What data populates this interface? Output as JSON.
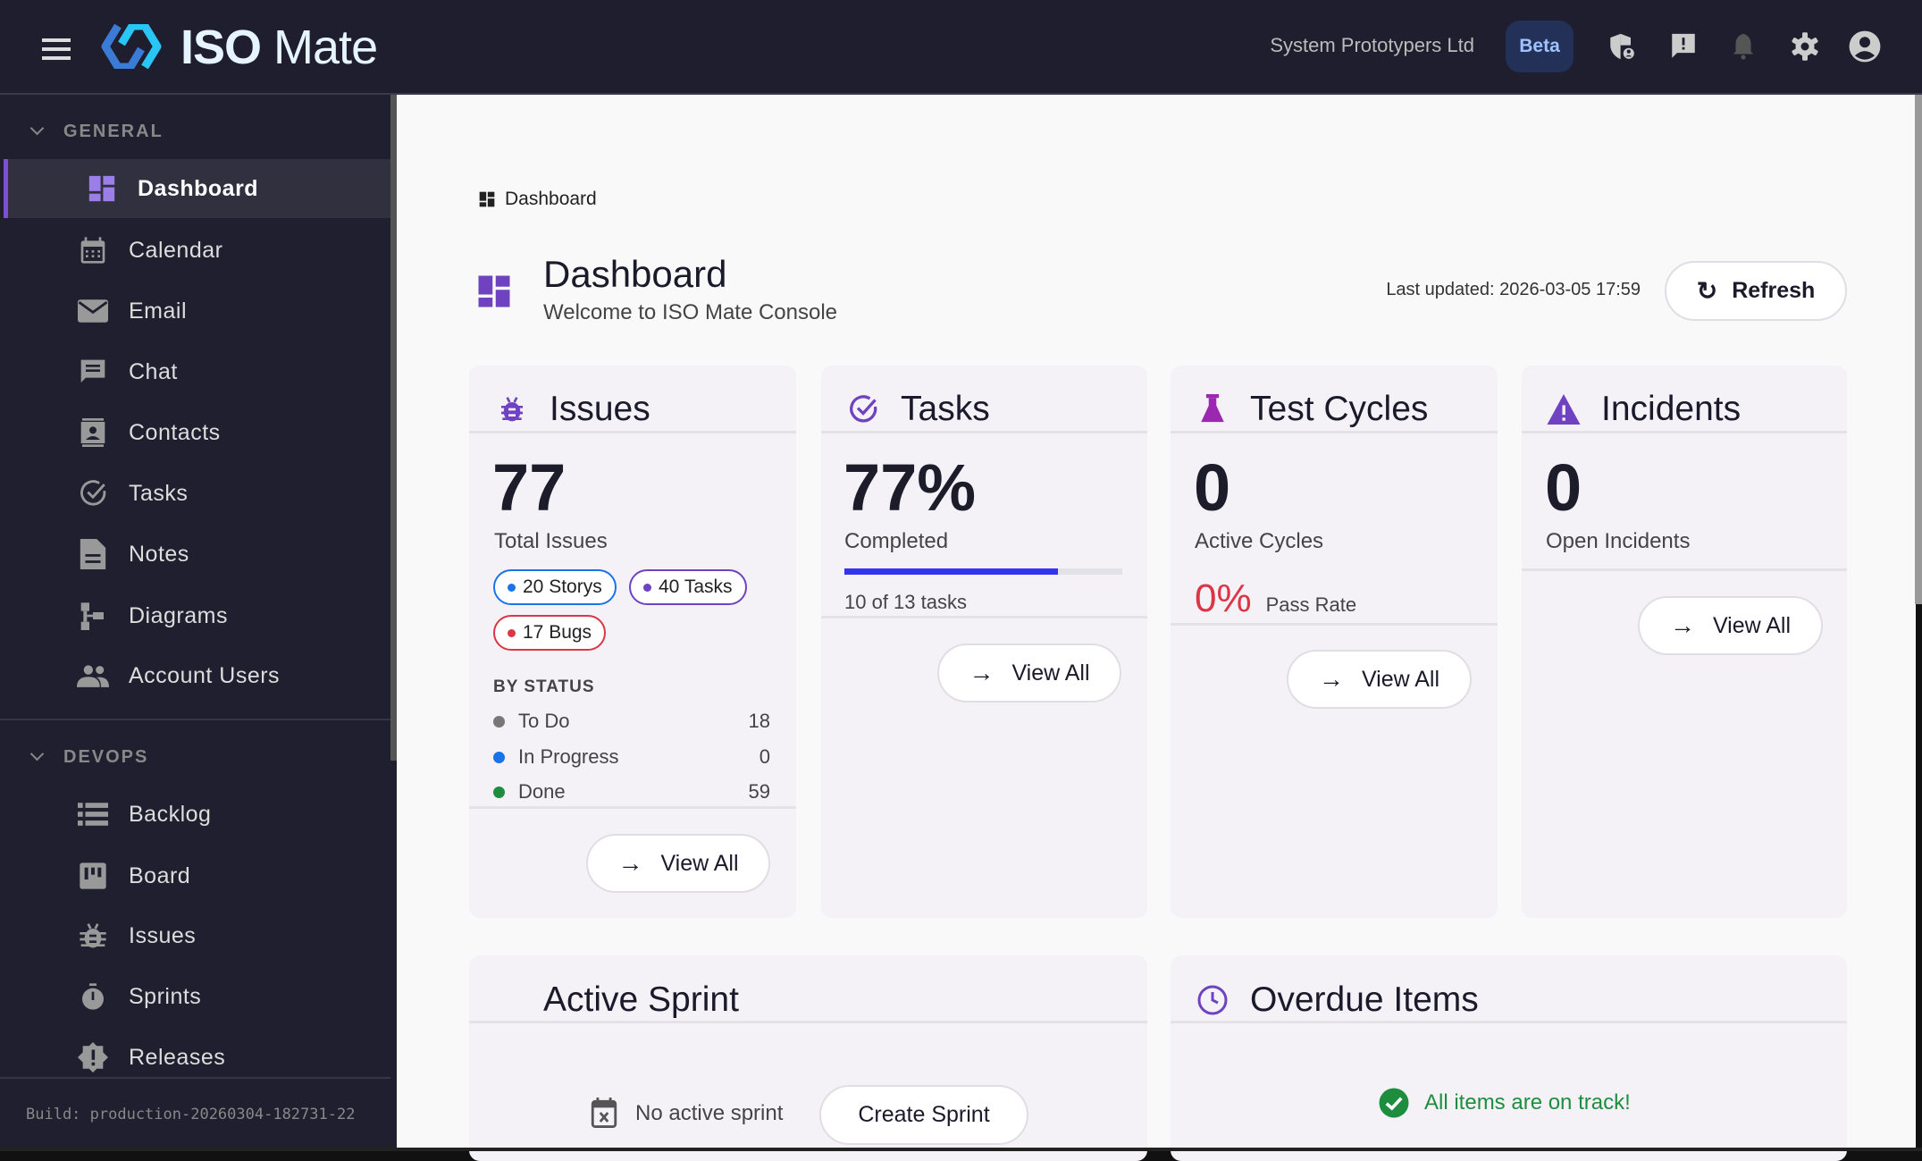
{
  "header": {
    "brand_bold": "ISO",
    "brand_light": "Mate",
    "organization": "System Prototypers Ltd",
    "badge": "Beta",
    "icons": [
      "menu-icon",
      "shield-user-icon",
      "feedback-icon",
      "bell-icon",
      "gear-icon",
      "account-icon"
    ]
  },
  "sidebar": {
    "sections": [
      {
        "title": "GENERAL",
        "items": [
          {
            "label": "Dashboard",
            "icon": "dashboard-icon",
            "active": true
          },
          {
            "label": "Calendar",
            "icon": "calendar-icon"
          },
          {
            "label": "Email",
            "icon": "email-icon"
          },
          {
            "label": "Chat",
            "icon": "chat-icon"
          },
          {
            "label": "Contacts",
            "icon": "contacts-icon"
          },
          {
            "label": "Tasks",
            "icon": "task-check-icon"
          },
          {
            "label": "Notes",
            "icon": "notes-icon"
          },
          {
            "label": "Diagrams",
            "icon": "diagram-icon"
          },
          {
            "label": "Account Users",
            "icon": "users-icon"
          }
        ]
      },
      {
        "title": "DEVOPS",
        "items": [
          {
            "label": "Backlog",
            "icon": "backlog-icon"
          },
          {
            "label": "Board",
            "icon": "board-icon"
          },
          {
            "label": "Issues",
            "icon": "bug-icon"
          },
          {
            "label": "Sprints",
            "icon": "timer-icon"
          },
          {
            "label": "Releases",
            "icon": "release-icon"
          }
        ]
      }
    ],
    "build": "Build: production-20260304-182731-22"
  },
  "main": {
    "breadcrumb": "Dashboard",
    "title": "Dashboard",
    "subtitle": "Welcome to ISO Mate Console",
    "last_updated": "Last updated: 2026-03-05 17:59",
    "refresh": "Refresh",
    "issues": {
      "title": "Issues",
      "total": "77",
      "total_label": "Total Issues",
      "chips": [
        {
          "label": "20 Storys",
          "color": "#1a73e8"
        },
        {
          "label": "40 Tasks",
          "color": "#6f42c1"
        },
        {
          "label": "17 Bugs",
          "color": "#dc3545"
        }
      ],
      "by_status": "BY STATUS",
      "status": [
        {
          "label": "To Do",
          "count": "18",
          "color": "#777"
        },
        {
          "label": "In Progress",
          "count": "0",
          "color": "#1a73e8"
        },
        {
          "label": "Done",
          "count": "59",
          "color": "#1e8e3e"
        }
      ],
      "view_all": "View All"
    },
    "tasks": {
      "title": "Tasks",
      "percent": "77%",
      "percent_label": "Completed",
      "progress": 77,
      "detail": "10 of 13 tasks",
      "view_all": "View All"
    },
    "test_cycles": {
      "title": "Test Cycles",
      "count": "0",
      "count_label": "Active Cycles",
      "pass_rate": "0%",
      "pass_label": "Pass Rate",
      "view_all": "View All"
    },
    "incidents": {
      "title": "Incidents",
      "count": "0",
      "count_label": "Open Incidents",
      "view_all": "View All"
    },
    "active_sprint": {
      "title": "Active Sprint",
      "empty": "No active sprint",
      "create": "Create Sprint"
    },
    "overdue": {
      "title": "Overdue Items",
      "message": "All items are on track!"
    }
  },
  "colors": {
    "accent": "#6f42c1",
    "progress": "#3434f0",
    "danger": "#dc3545",
    "success": "#1e8e3e"
  }
}
